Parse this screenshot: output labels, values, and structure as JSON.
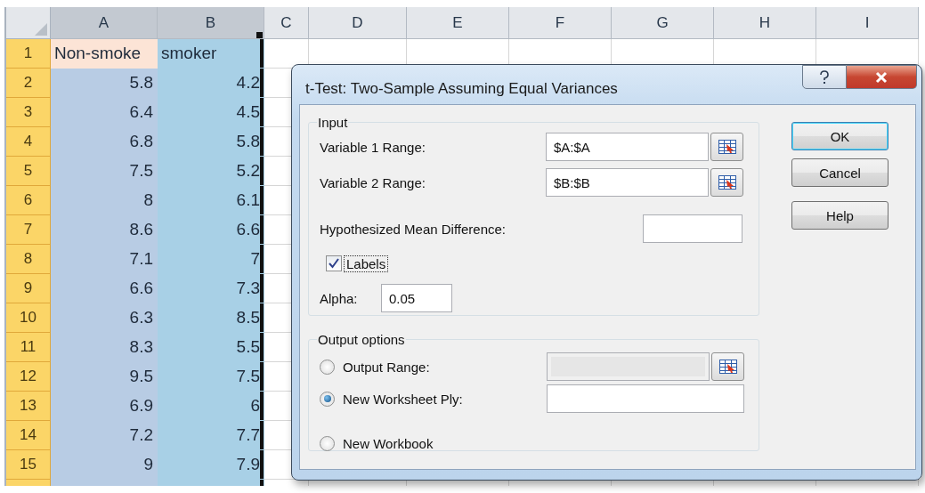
{
  "spreadsheet": {
    "columns": [
      {
        "label": "A",
        "selected": true,
        "color": "#b8cce4"
      },
      {
        "label": "B",
        "selected": true,
        "color": "#a8d0e6"
      },
      {
        "label": "C",
        "selected": false
      },
      {
        "label": "D",
        "selected": false
      },
      {
        "label": "E",
        "selected": false
      },
      {
        "label": "F",
        "selected": false
      },
      {
        "label": "G",
        "selected": false
      },
      {
        "label": "H",
        "selected": false
      },
      {
        "label": "I",
        "selected": false
      }
    ],
    "rows": [
      {
        "number": "1",
        "selected": true,
        "cells": [
          {
            "text": "Non-smoke",
            "kind": "text",
            "active": true
          },
          {
            "text": "smoker",
            "kind": "text",
            "active": false
          }
        ]
      },
      {
        "number": "2",
        "selected": true,
        "cells": [
          {
            "text": "5.8",
            "kind": "number",
            "active": false
          },
          {
            "text": "4.2",
            "kind": "number",
            "active": false
          }
        ]
      },
      {
        "number": "3",
        "selected": true,
        "cells": [
          {
            "text": "6.4",
            "kind": "number",
            "active": false
          },
          {
            "text": "4.5",
            "kind": "number",
            "active": false
          }
        ]
      },
      {
        "number": "4",
        "selected": true,
        "cells": [
          {
            "text": "6.8",
            "kind": "number",
            "active": false
          },
          {
            "text": "5.8",
            "kind": "number",
            "active": false
          }
        ]
      },
      {
        "number": "5",
        "selected": true,
        "cells": [
          {
            "text": "7.5",
            "kind": "number",
            "active": false
          },
          {
            "text": "5.2",
            "kind": "number",
            "active": false
          }
        ]
      },
      {
        "number": "6",
        "selected": true,
        "cells": [
          {
            "text": "8",
            "kind": "number",
            "active": false
          },
          {
            "text": "6.1",
            "kind": "number",
            "active": false
          }
        ]
      },
      {
        "number": "7",
        "selected": true,
        "cells": [
          {
            "text": "8.6",
            "kind": "number",
            "active": false
          },
          {
            "text": "6.6",
            "kind": "number",
            "active": false
          }
        ]
      },
      {
        "number": "8",
        "selected": true,
        "cells": [
          {
            "text": "7.1",
            "kind": "number",
            "active": false
          },
          {
            "text": "7",
            "kind": "number",
            "active": false
          }
        ]
      },
      {
        "number": "9",
        "selected": true,
        "cells": [
          {
            "text": "6.6",
            "kind": "number",
            "active": false
          },
          {
            "text": "7.3",
            "kind": "number",
            "active": false
          }
        ]
      },
      {
        "number": "10",
        "selected": true,
        "cells": [
          {
            "text": "6.3",
            "kind": "number",
            "active": false
          },
          {
            "text": "8.5",
            "kind": "number",
            "active": false
          }
        ]
      },
      {
        "number": "11",
        "selected": true,
        "cells": [
          {
            "text": "8.3",
            "kind": "number",
            "active": false
          },
          {
            "text": "5.5",
            "kind": "number",
            "active": false
          }
        ]
      },
      {
        "number": "12",
        "selected": true,
        "cells": [
          {
            "text": "9.5",
            "kind": "number",
            "active": false
          },
          {
            "text": "7.5",
            "kind": "number",
            "active": false
          }
        ]
      },
      {
        "number": "13",
        "selected": true,
        "cells": [
          {
            "text": "6.9",
            "kind": "number",
            "active": false
          },
          {
            "text": "6",
            "kind": "number",
            "active": false
          }
        ]
      },
      {
        "number": "14",
        "selected": true,
        "cells": [
          {
            "text": "7.2",
            "kind": "number",
            "active": false
          },
          {
            "text": "7.7",
            "kind": "number",
            "active": false
          }
        ]
      },
      {
        "number": "15",
        "selected": true,
        "cells": [
          {
            "text": "9",
            "kind": "number",
            "active": false
          },
          {
            "text": "7.9",
            "kind": "number",
            "active": false
          }
        ]
      }
    ]
  },
  "dialog": {
    "title": "t-Test: Two-Sample Assuming Equal Variances",
    "input_group": {
      "legend": "Input",
      "fields": [
        {
          "kind": "range",
          "label": "Variable 1 Range:",
          "value": "$A:$A"
        },
        {
          "kind": "range",
          "label": "Variable 2 Range:",
          "value": "$B:$B"
        },
        {
          "kind": "text",
          "label": "Hypothesized Mean Difference:"
        }
      ],
      "labels_checkbox": {
        "label": "Labels",
        "checked": true,
        "focused": true
      },
      "alpha": {
        "label": "Alpha:",
        "value": "0.05"
      }
    },
    "output_group": {
      "legend": "Output options",
      "options": [
        {
          "kind": "range",
          "label": "Output Range:",
          "selected": false,
          "disabled": true
        },
        {
          "kind": "text",
          "label": "New Worksheet Ply:",
          "selected": true,
          "disabled": false
        },
        {
          "kind": "plain",
          "label": "New Workbook",
          "selected": false
        }
      ]
    },
    "buttons": [
      {
        "label": "OK",
        "default": true
      },
      {
        "label": "Cancel",
        "default": false
      },
      {
        "label": "Help",
        "default": false
      }
    ]
  }
}
